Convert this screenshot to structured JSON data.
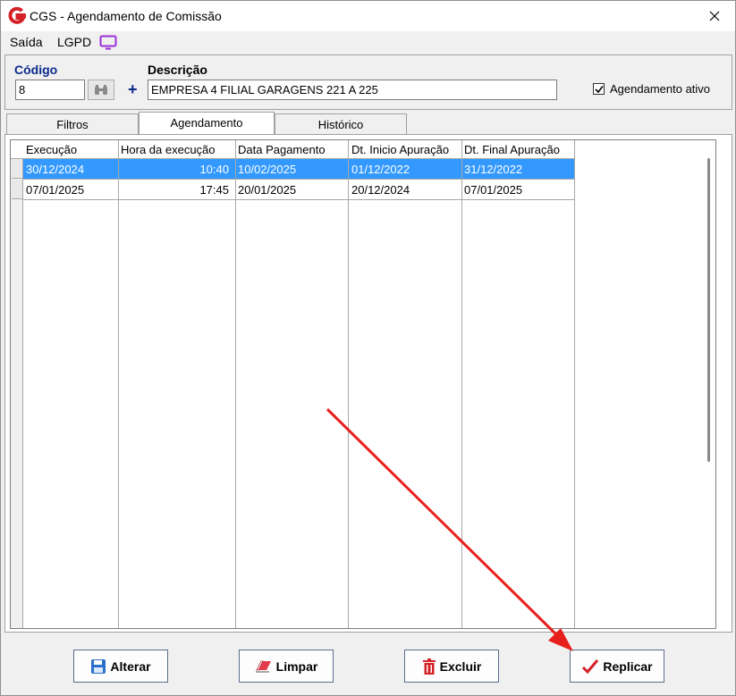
{
  "window": {
    "title": "CGS - Agendamento de Comissão",
    "app_icon": "cgs-logo-icon",
    "accent_color": "#d42027"
  },
  "menu": {
    "items": [
      {
        "label": "Saída"
      },
      {
        "label": "LGPD"
      }
    ],
    "monitor_icon": "monitor-icon"
  },
  "header": {
    "codigo_label": "Código",
    "codigo_value": "8",
    "descricao_label": "Descrição",
    "descricao_value": "EMPRESA 4 FILIAL GARAGENS 221 A 225",
    "checkbox_label": "Agendamento ativo",
    "checkbox_checked": true
  },
  "tabs": [
    {
      "label": "Filtros",
      "active": false
    },
    {
      "label": "Agendamento",
      "active": true
    },
    {
      "label": "Histórico",
      "active": false
    }
  ],
  "grid": {
    "columns": [
      "Execução",
      "Hora da execução",
      "Data Pagamento",
      "Dt. Inicio Apuração",
      "Dt. Final Apuração"
    ],
    "rows": [
      {
        "execucao": "30/12/2024",
        "hora": "10:40",
        "pagamento": "10/02/2025",
        "inicio": "01/12/2022",
        "final": "31/12/2022",
        "selected": true
      },
      {
        "execucao": "07/01/2025",
        "hora": "17:45",
        "pagamento": "20/01/2025",
        "inicio": "20/12/2024",
        "final": "07/01/2025",
        "selected": false
      }
    ],
    "selection_color": "#3399ff"
  },
  "buttons": {
    "alterar": "Alterar",
    "limpar": "Limpar",
    "excluir": "Excluir",
    "replicar": "Replicar"
  },
  "annotation": {
    "arrow_color": "#e8201c",
    "target": "replicar-button"
  }
}
